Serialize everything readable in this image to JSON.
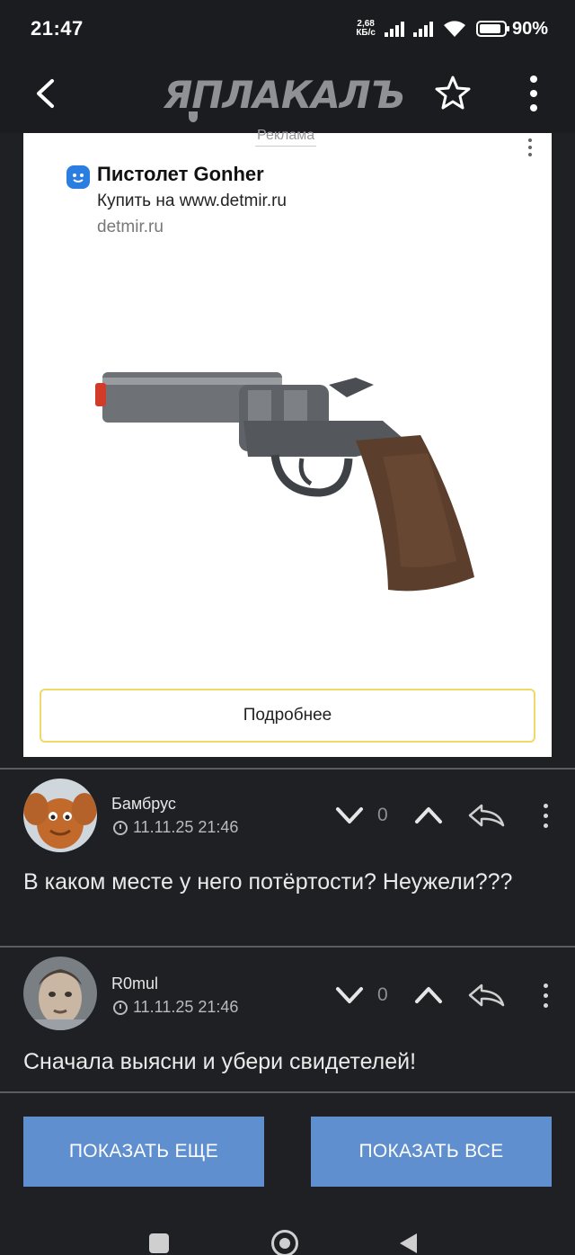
{
  "status_bar": {
    "time": "21:47",
    "net_speed_value": "2,68",
    "net_speed_unit": "КБ/с",
    "battery": "90%",
    "battery_level": 0.9
  },
  "app_bar": {
    "logo": "ЯПЛАКАЛЪ",
    "icons": [
      "back-arrow-icon",
      "star-icon",
      "more-vertical-icon"
    ]
  },
  "ad": {
    "label": "Реклама",
    "title": "Пистолет Gonher",
    "subtitle": "Купить на www.detmir.ru",
    "domain": "detmir.ru",
    "button": "Подробнее",
    "icon_color": "#2a7de1"
  },
  "comments": [
    {
      "author": "Бамбрус",
      "date": "11.11.25 21:46",
      "votes": "0",
      "text": "В каком месте у него потёртости? Неужели???"
    },
    {
      "author": "R0mul",
      "date": "11.11.25 21:46",
      "votes": "0",
      "text": "Сначала выясни и убери свидетелей!"
    }
  ],
  "buttons": {
    "show_more": "ПОКАЗАТЬ ЕЩЕ",
    "show_all": "ПОКАЗАТЬ ВСЕ",
    "color": "#5f8fcf"
  },
  "colors": {
    "background": "#1e2024",
    "ad_button_border": "#efd96a"
  }
}
